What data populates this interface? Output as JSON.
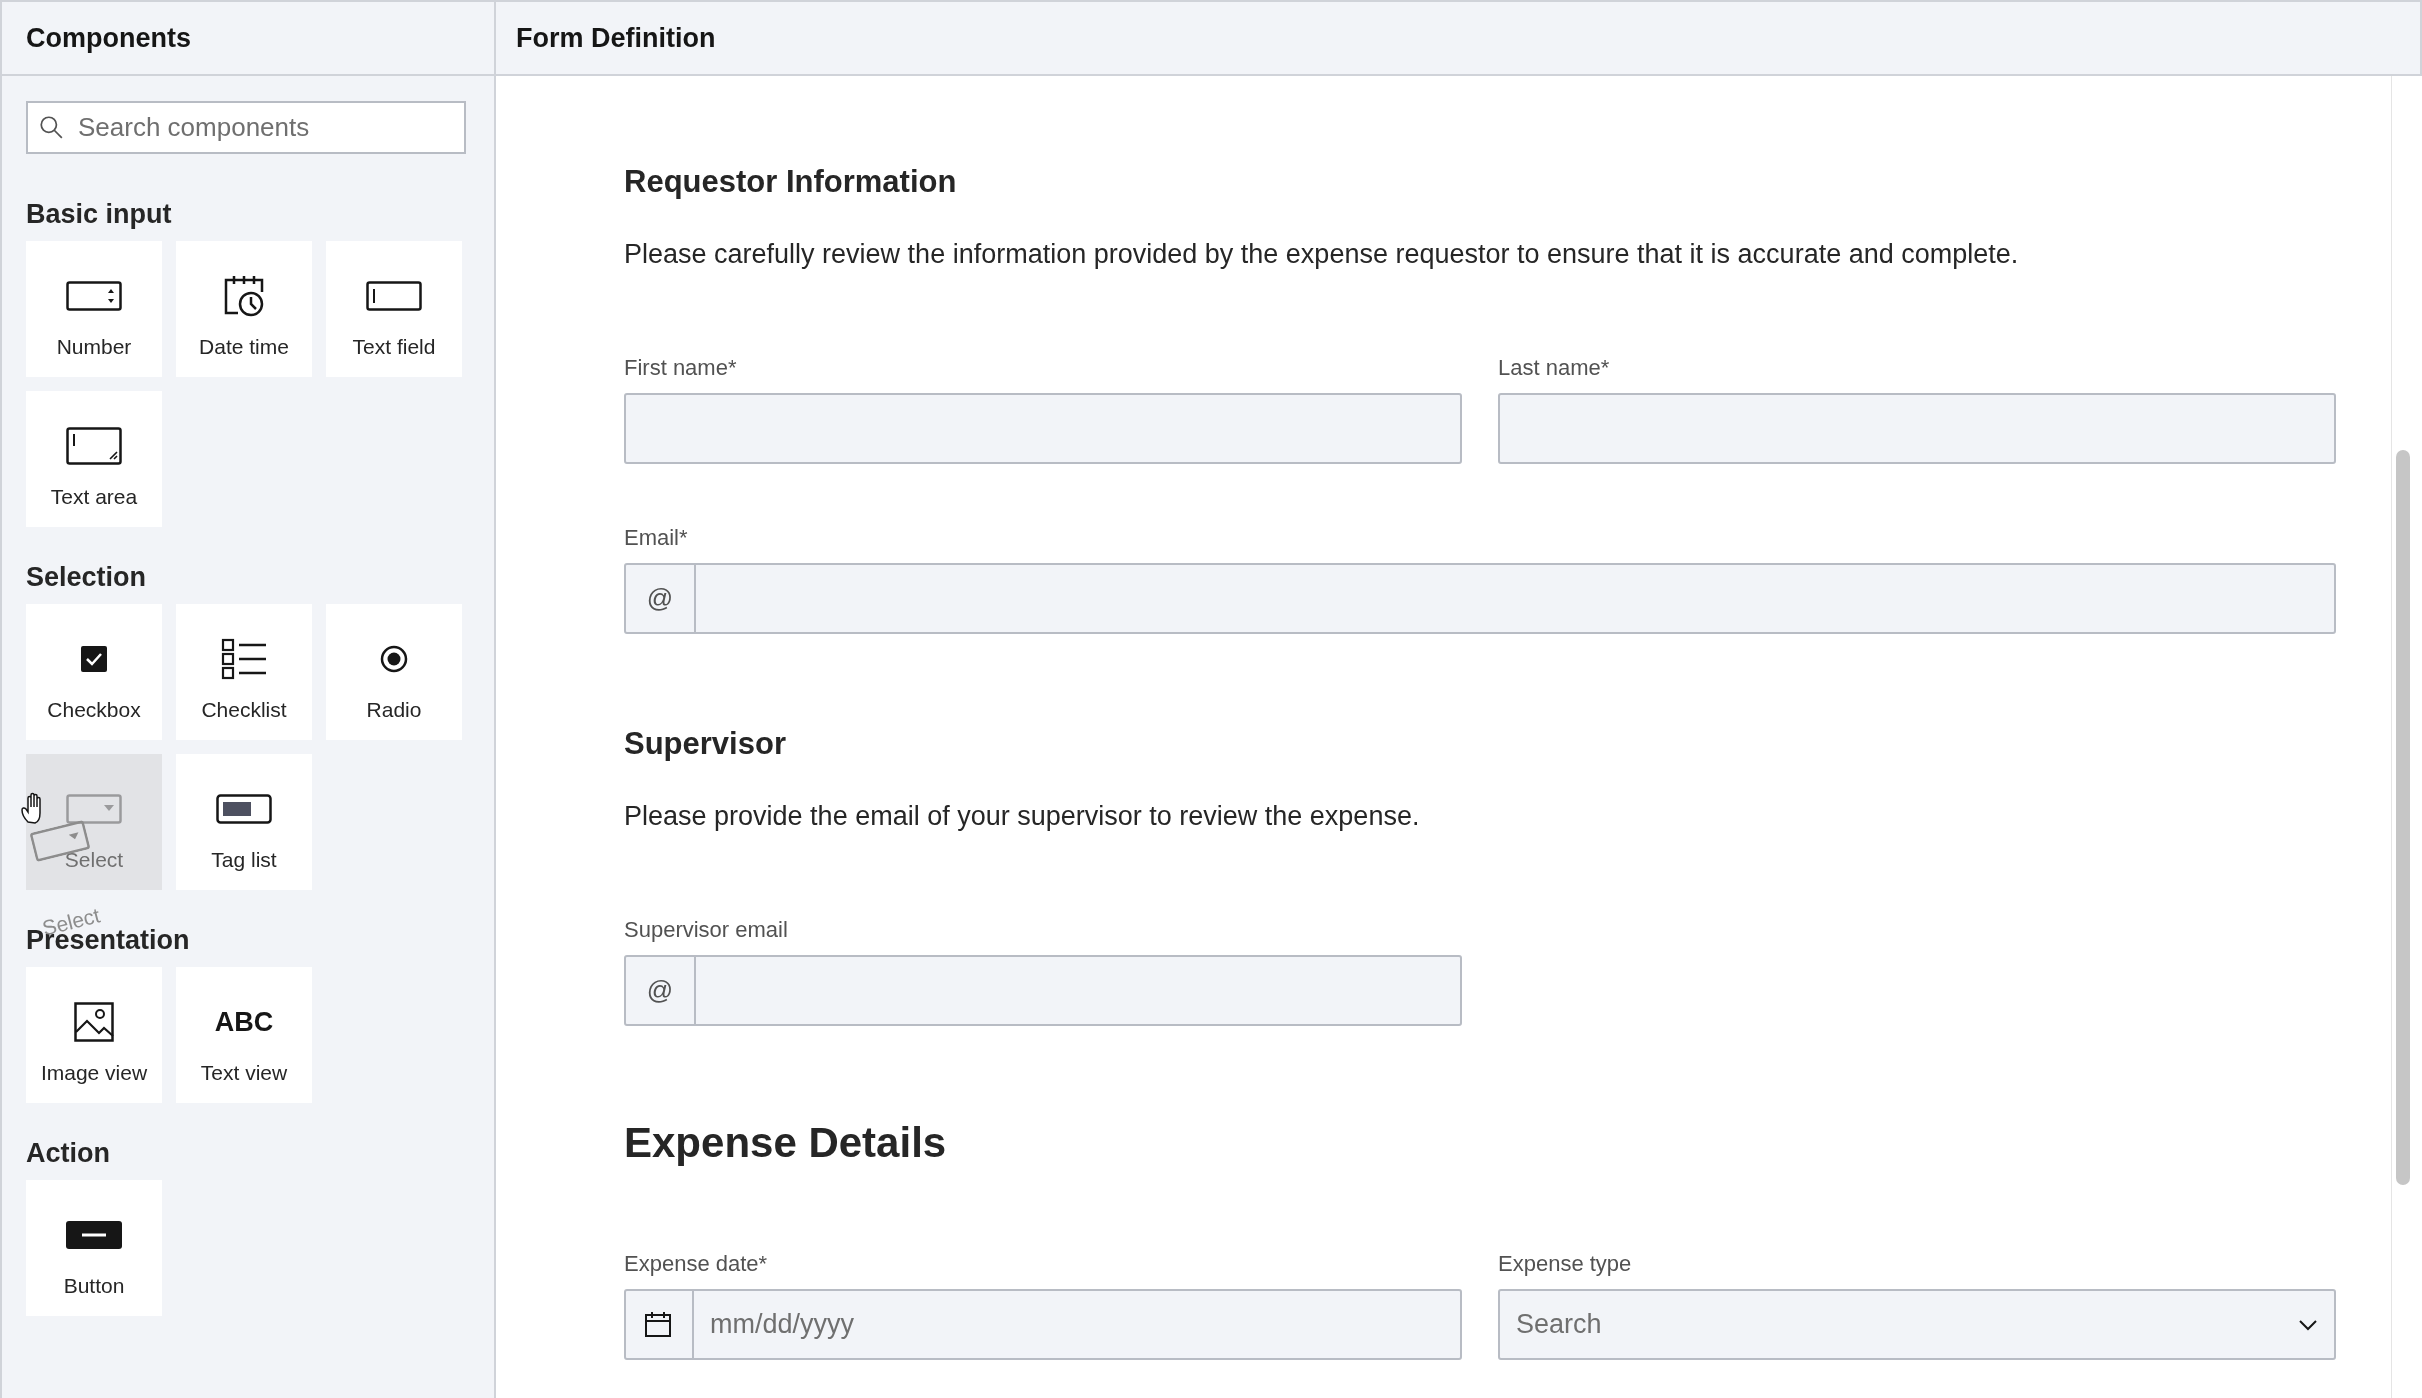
{
  "sidebar": {
    "title": "Components",
    "search": {
      "placeholder": "Search components"
    },
    "sections": [
      {
        "title": "Basic input",
        "items": [
          {
            "label": "Number",
            "kind": "number",
            "dragging": false
          },
          {
            "label": "Date time",
            "kind": "datetime",
            "dragging": false
          },
          {
            "label": "Text field",
            "kind": "textfield",
            "dragging": false
          },
          {
            "label": "Text area",
            "kind": "textarea",
            "dragging": false
          }
        ]
      },
      {
        "title": "Selection",
        "items": [
          {
            "label": "Checkbox",
            "kind": "checkbox",
            "dragging": false
          },
          {
            "label": "Checklist",
            "kind": "checklist",
            "dragging": false
          },
          {
            "label": "Radio",
            "kind": "radio",
            "dragging": false
          },
          {
            "label": "Select",
            "kind": "select",
            "dragging": true
          },
          {
            "label": "Tag list",
            "kind": "taglist",
            "dragging": false
          }
        ]
      },
      {
        "title": "Presentation",
        "items": [
          {
            "label": "Image view",
            "kind": "imageview",
            "dragging": false
          },
          {
            "glyph": "ABC",
            "label": "Text view",
            "kind": "textview",
            "dragging": false
          }
        ]
      },
      {
        "title": "Action",
        "items": [
          {
            "label": "Button",
            "kind": "button",
            "dragging": false
          }
        ]
      }
    ],
    "drag_ghost": {
      "label": "Select",
      "kind": "select"
    }
  },
  "form": {
    "title": "Form Definition",
    "sections": [
      {
        "title": "Requestor Information",
        "kind": "h3",
        "description": "Please carefully review the information provided by the expense requestor to ensure that it is accurate and complete.",
        "rows": [
          {
            "fields": [
              {
                "label": "First name*",
                "kind": "text"
              },
              {
                "label": "Last name*",
                "kind": "text"
              }
            ]
          },
          {
            "fields": [
              {
                "label": "Email*",
                "kind": "email",
                "prefix": "@",
                "wide": true
              }
            ]
          }
        ]
      },
      {
        "title": "Supervisor",
        "kind": "h3",
        "description": "Please provide the email of your supervisor to review the expense.",
        "rows": [
          {
            "fields": [
              {
                "label": "Supervisor email",
                "kind": "email",
                "prefix": "@",
                "wide": false
              }
            ]
          }
        ]
      },
      {
        "title": "Expense Details",
        "kind": "h2",
        "rows": [
          {
            "fields": [
              {
                "label": "Expense date*",
                "kind": "date",
                "placeholder": "mm/dd/yyyy"
              },
              {
                "label": "Expense type",
                "kind": "select",
                "placeholder": "Search"
              }
            ]
          }
        ]
      }
    ]
  }
}
